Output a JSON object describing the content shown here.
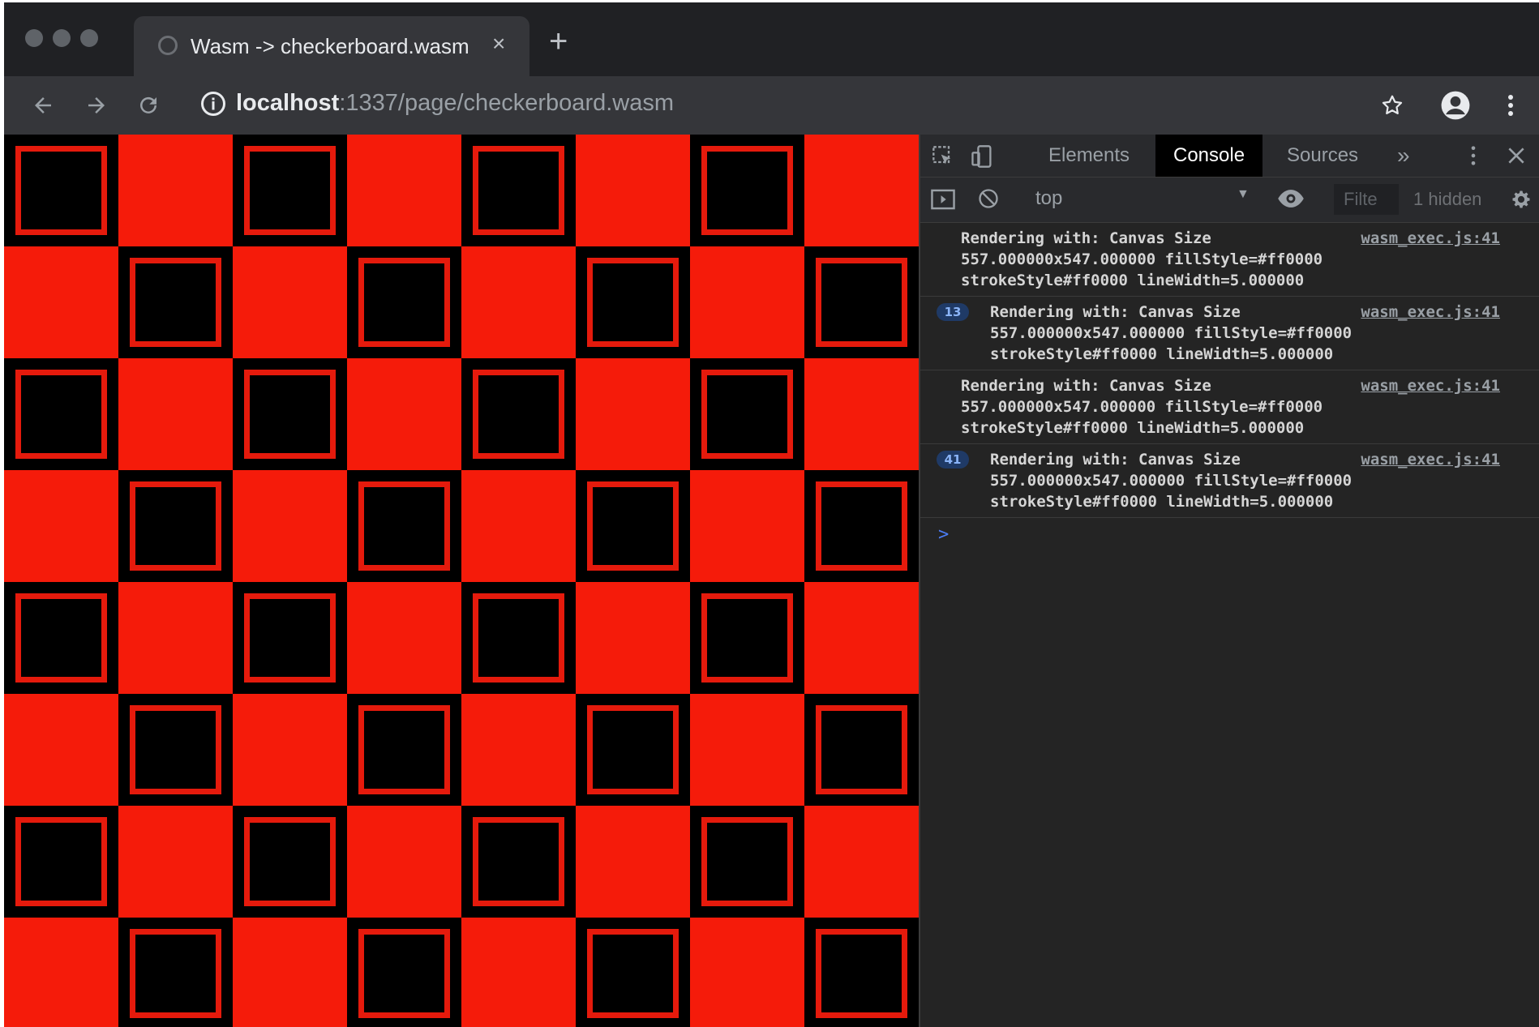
{
  "browser": {
    "tab_title": "Wasm -> checkerboard.wasm",
    "tab_close_glyph": "×",
    "new_tab_glyph": "+",
    "url_host": "localhost",
    "url_rest": ":1337/page/checkerboard.wasm"
  },
  "page": {
    "checkerboard": {
      "rows": 8,
      "columns": 8,
      "colors": {
        "red": "#f51b0a",
        "black": "#000000",
        "inner_border": "#e51a0c"
      }
    }
  },
  "devtools": {
    "tabs": [
      {
        "label": "Elements",
        "active": false
      },
      {
        "label": "Console",
        "active": true
      },
      {
        "label": "Sources",
        "active": false
      }
    ],
    "more_tabs_glyph": "»",
    "context": "top",
    "filter_placeholder": "Filte",
    "hidden_count": "1 hidden",
    "messages": [
      {
        "badge": "",
        "lines": [
          "Rendering with: Canvas Size",
          "557.000000x547.000000  fillStyle=#ff0000",
          "strokeStyle#ff0000 lineWidth=5.000000"
        ],
        "source": "wasm_exec.js:41"
      },
      {
        "badge": "13",
        "lines": [
          "Rendering with: Canvas Size",
          "557.000000x547.000000  fillStyle=#ff0000",
          "strokeStyle#ff0000 lineWidth=5.000000"
        ],
        "source": "wasm_exec.js:41"
      },
      {
        "badge": "",
        "lines": [
          "Rendering with: Canvas Size",
          "557.000000x547.000000  fillStyle=#ff0000",
          "strokeStyle#ff0000 lineWidth=5.000000"
        ],
        "source": "wasm_exec.js:41"
      },
      {
        "badge": "41",
        "lines": [
          "Rendering with: Canvas Size",
          "557.000000x547.000000  fillStyle=#ff0000",
          "strokeStyle#ff0000 lineWidth=5.000000"
        ],
        "source": "wasm_exec.js:41"
      }
    ],
    "prompt_glyph": ">"
  },
  "colors": {
    "chrome_dark": "#202124",
    "toolbar": "#35363a",
    "devtools_bg": "#242424",
    "accent_blue": "#8ab4f8"
  },
  "icons": [
    "back-arrow-icon",
    "forward-arrow-icon",
    "reload-icon",
    "info-icon",
    "star-icon",
    "profile-icon",
    "kebab-menu-icon",
    "inspect-element-icon",
    "device-toolbar-icon",
    "close-icon",
    "sidebar-toggle-icon",
    "clear-console-icon",
    "eye-icon",
    "gear-icon"
  ]
}
